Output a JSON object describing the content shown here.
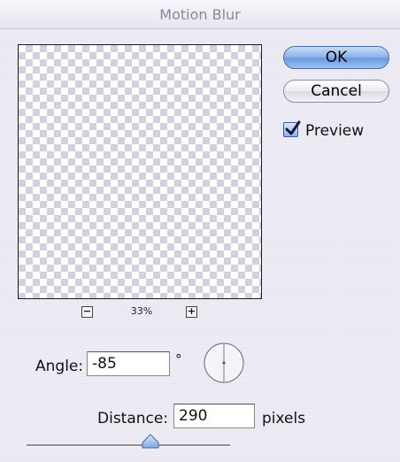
{
  "window": {
    "title": "Motion Blur"
  },
  "buttons": {
    "ok": "OK",
    "cancel": "Cancel"
  },
  "preview": {
    "checkbox_label": "Preview",
    "checked": true
  },
  "zoom": {
    "minus": "−",
    "plus": "+",
    "level": "33%"
  },
  "angle": {
    "label": "Angle:",
    "value": "-85",
    "unit": "°"
  },
  "distance": {
    "label": "Distance:",
    "value": "290",
    "unit": "pixels"
  },
  "slider": {
    "value": 290
  },
  "icons": {
    "zoom_out": "zoom-out-icon",
    "zoom_in": "zoom-in-icon",
    "checkmark": "checkmark-icon",
    "angle_dial": "angle-dial",
    "slider_thumb": "slider-thumb"
  },
  "colors": {
    "accent": "#6a9be0",
    "checker": "#d2d1e2"
  }
}
